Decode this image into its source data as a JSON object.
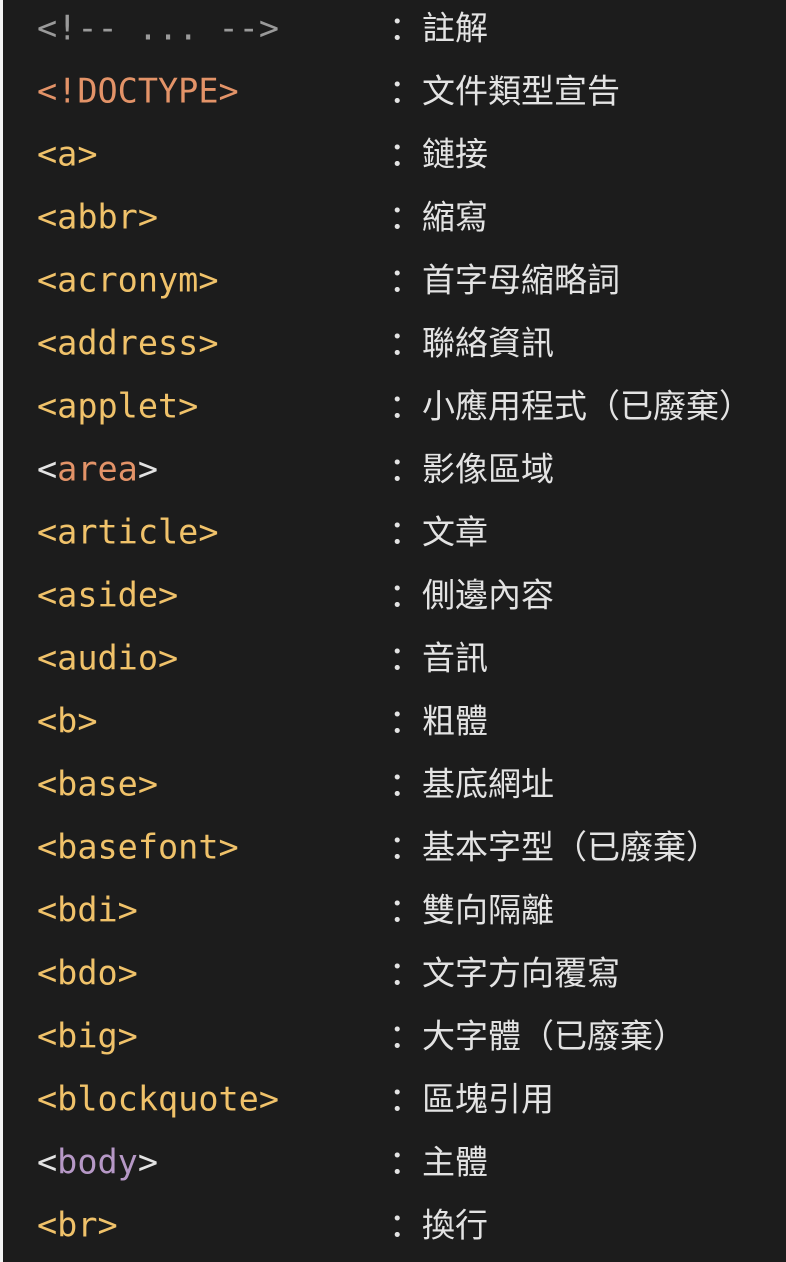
{
  "colors": {
    "background": "#1c1c1c",
    "tag": "#f0c26a",
    "comment": "#9a9a9a",
    "doctype": "#e39368",
    "bracket_plain": "#e3e3e3",
    "area_name": "#e39368",
    "body_name": "#b698c6",
    "description": "#e3e3e3"
  },
  "rows": [
    {
      "tag": "<!-- ... -->",
      "desc": "：註解"
    },
    {
      "tag": "<!DOCTYPE>",
      "desc": "：文件類型宣告"
    },
    {
      "tag": "<a>",
      "desc": "：鏈接"
    },
    {
      "tag": "<abbr>",
      "desc": "：縮寫"
    },
    {
      "tag": "<acronym>",
      "desc": "：首字母縮略詞"
    },
    {
      "tag": "<address>",
      "desc": "：聯絡資訊"
    },
    {
      "tag": "<applet>",
      "desc": "：小應用程式（已廢棄）"
    },
    {
      "tag_open": "<",
      "tag_name": "area",
      "tag_close": ">",
      "desc": "：影像區域"
    },
    {
      "tag": "<article>",
      "desc": "：文章"
    },
    {
      "tag": "<aside>",
      "desc": "：側邊內容"
    },
    {
      "tag": "<audio>",
      "desc": "：音訊"
    },
    {
      "tag": "<b>",
      "desc": "：粗體"
    },
    {
      "tag": "<base>",
      "desc": "：基底網址"
    },
    {
      "tag": "<basefont>",
      "desc": "：基本字型（已廢棄）"
    },
    {
      "tag": "<bdi>",
      "desc": "：雙向隔離"
    },
    {
      "tag": "<bdo>",
      "desc": "：文字方向覆寫"
    },
    {
      "tag": "<big>",
      "desc": "：大字體（已廢棄）"
    },
    {
      "tag": "<blockquote>",
      "desc": "：區塊引用"
    },
    {
      "tag_open": "<",
      "tag_name": "body",
      "tag_close": ">",
      "desc": "：主體"
    },
    {
      "tag": "<br>",
      "desc": "：換行"
    }
  ]
}
